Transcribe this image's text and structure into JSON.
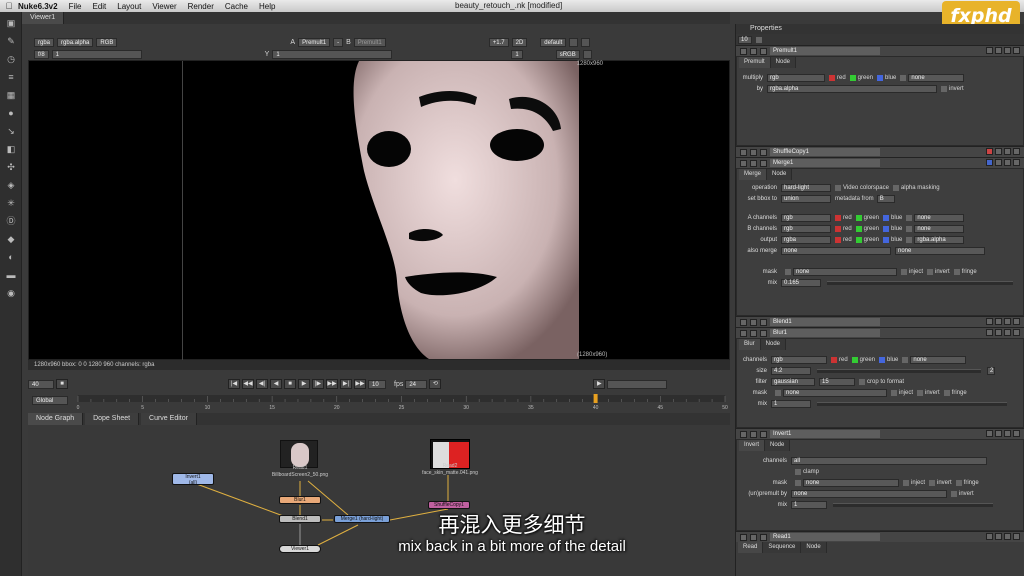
{
  "menubar": {
    "app": "Nuke6.3v2",
    "items": [
      "File",
      "Edit",
      "Layout",
      "Viewer",
      "Render",
      "Cache",
      "Help"
    ],
    "window_title": "beauty_retouch_.nk [modified]"
  },
  "logo": "fxphd",
  "viewer": {
    "tab": "Viewer1",
    "row1": {
      "channels": "rgba",
      "alpha": "rgba.alpha",
      "display": "RGB",
      "a_label": "A",
      "a_input": "Premult1",
      "a_op": "-",
      "b_label": "B",
      "b_input": "Premult1",
      "gain": "+1.7",
      "mode": "2D",
      "lut_label": "default"
    },
    "row2": {
      "frame": "f/8",
      "frame_num": "1",
      "y_label": "Y",
      "y_value": "1",
      "zoom": "1",
      "colorspace": "sRGB"
    },
    "res_top": "1280x960",
    "res_bottom": "(1280x960)",
    "info": "1280x960 bbox: 0 0 1280 960 channels: rgba"
  },
  "playback": {
    "current_frame": "40",
    "step": "10",
    "fps_label": "fps",
    "fps": "24"
  },
  "timeline": {
    "range": "Global",
    "ticks": [
      "0",
      "5",
      "10",
      "15",
      "20",
      "25",
      "30",
      "35",
      "40",
      "45",
      "50"
    ],
    "current": 40
  },
  "graph_tabs": [
    "Node Graph",
    "Dope Sheet",
    "Curve Editor"
  ],
  "graph": {
    "nodes": {
      "invert": "Invert1",
      "invert_sub": "(all)",
      "read1": "Read1",
      "read1_file": "BillboardScreen2_50.png",
      "blur": "Blur1",
      "blend": "Blend1",
      "merge": "Merge1 (hard-light)",
      "read2": "Read2",
      "read2_file": "face_skin_matte.041.png",
      "shuffle": "ShuffleCopy1",
      "viewer": "Viewer1"
    }
  },
  "properties": {
    "title": "Properties",
    "max_panels": "10",
    "premult": {
      "name": "Premult1",
      "tabs": [
        "Premult",
        "Node"
      ],
      "multiply_label": "multiply",
      "multiply": "rgb",
      "by_label": "by",
      "by": "rgba.alpha",
      "red": "red",
      "green": "green",
      "blue": "blue",
      "none": "none",
      "invert": "invert"
    },
    "shuffle": {
      "name": "ShuffleCopy1"
    },
    "merge": {
      "name": "Merge1",
      "tabs": [
        "Merge",
        "Node"
      ],
      "operation_label": "operation",
      "operation": "hard-light",
      "video_colorspace": "Video colorspace",
      "alpha_masking": "alpha masking",
      "set_bbox_label": "set bbox to",
      "set_bbox": "union",
      "metadata_label": "metadata from",
      "metadata": "B",
      "a_channels_label": "A channels",
      "a_channels": "rgb",
      "b_channels_label": "B channels",
      "b_channels": "rgb",
      "output_label": "output",
      "output": "rgba",
      "also_merge_label": "also merge",
      "also_merge": "none",
      "rgba_alpha": "rgba.alpha",
      "mask_label": "mask",
      "mask": "none",
      "inject": "inject",
      "invert": "invert",
      "fringe": "fringe",
      "mix_label": "mix",
      "mix": "0.165"
    },
    "blend": {
      "name": "Blend1"
    },
    "blur": {
      "name": "Blur1",
      "tabs": [
        "Blur",
        "Node"
      ],
      "channels_label": "channels",
      "channels": "rgb",
      "size_label": "size",
      "size": "4.2",
      "size_count": "2",
      "filter_label": "filter",
      "filter": "gaussian",
      "filter_quality": "15",
      "crop": "crop to format",
      "mask_label": "mask",
      "mask": "none",
      "mix_label": "mix",
      "mix": "1"
    },
    "invert": {
      "name": "Invert1",
      "tabs": [
        "Invert",
        "Node"
      ],
      "channels_label": "channels",
      "channels": "all",
      "clamp": "clamp",
      "mask_label": "mask",
      "mask": "none",
      "unpremult_label": "(un)premult by",
      "unpremult": "none",
      "mix_label": "mix",
      "mix": "1"
    },
    "read": {
      "name": "Read1",
      "tabs": [
        "Read",
        "Sequence",
        "Node"
      ]
    }
  },
  "subtitles": {
    "cn": "再混入更多细节",
    "en": "mix back in a bit more of the detail"
  },
  "colors": {
    "node_read": "#bdbdbd",
    "node_blur": "#e8a878",
    "node_merge": "#7aa0d8",
    "node_invert": "#9fb8e8",
    "node_shuffle": "#c060a0",
    "accent_logo": "#e8b32a"
  }
}
